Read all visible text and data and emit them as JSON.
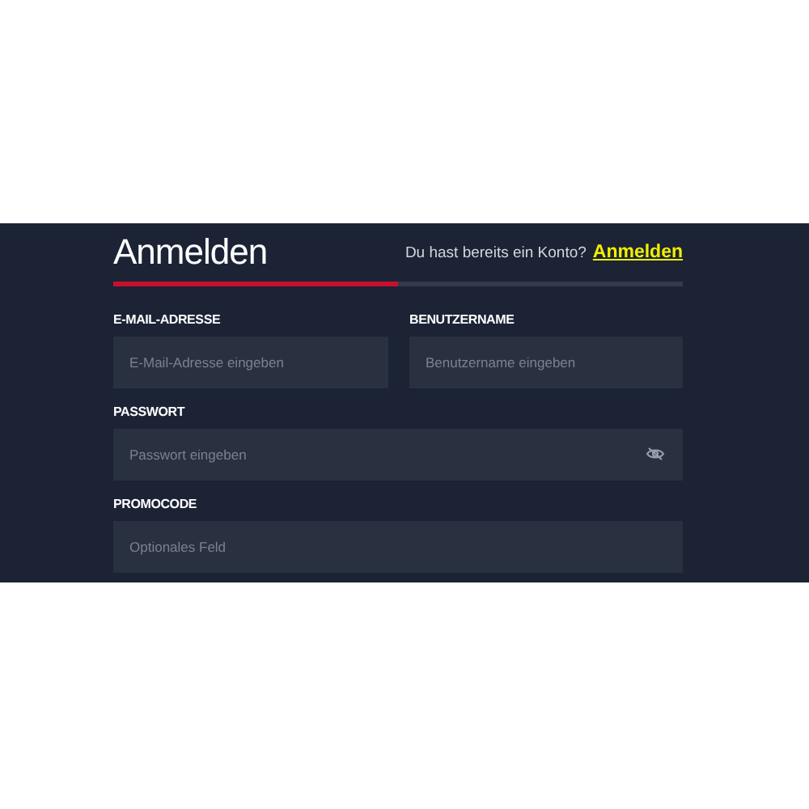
{
  "title": "Anmelden",
  "login_prompt": {
    "text": "Du hast bereits ein Konto?",
    "link": "Anmelden"
  },
  "progress": {
    "level": 0.5
  },
  "fields": [
    {
      "label": "E-MAIL-ADRESSE",
      "placeholder": "E-Mail-Adresse eingeben",
      "kind": "half"
    },
    {
      "label": "BENUTZERNAME",
      "placeholder": "Benutzername eingeben",
      "kind": "half"
    },
    {
      "label": "PASSWORT",
      "placeholder": "Passwort eingeben",
      "kind": "password"
    },
    {
      "label": "PROMOCODE",
      "placeholder": "Optionales Feld",
      "kind": "full"
    }
  ]
}
